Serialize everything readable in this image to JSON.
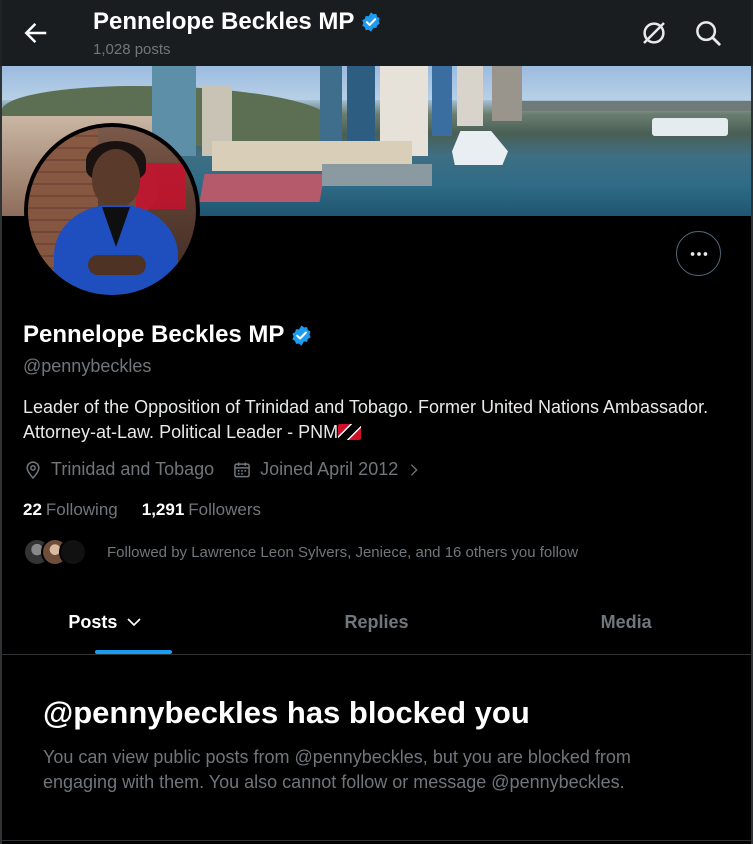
{
  "header": {
    "title": "Pennelope Beckles MP",
    "posts_count": "1,028 posts"
  },
  "profile": {
    "name": "Pennelope Beckles MP",
    "handle": "@pennybeckles",
    "bio": "Leader of the Opposition of Trinidad and Tobago. Former United Nations Ambassador. Attorney-at-Law. Political Leader - PNM",
    "location": "Trinidad and Tobago",
    "joined": "Joined April 2012",
    "following_count": "22",
    "following_label": "Following",
    "followers_count": "1,291",
    "followers_label": "Followers",
    "followed_by": "Followed by Lawrence Leon Sylvers, Jeniece, and 16 others you follow"
  },
  "tabs": [
    {
      "label": "Posts"
    },
    {
      "label": "Replies"
    },
    {
      "label": "Media"
    }
  ],
  "blocked": {
    "title": "@pennybeckles has blocked you",
    "message": "You can view public posts from @pennybeckles, but you are blocked from engaging with them. You also cannot follow or message @pennybeckles."
  },
  "colors": {
    "accent": "#1d9bf0",
    "background": "#000000",
    "muted": "#71767b",
    "verified": "#1d9bf0"
  },
  "icons": [
    "back-arrow-icon",
    "verified-badge-icon",
    "grok-icon",
    "search-icon",
    "more-icon",
    "location-icon",
    "calendar-icon",
    "chevron-right-icon",
    "chevron-down-icon",
    "trinidad-flag-emoji"
  ]
}
